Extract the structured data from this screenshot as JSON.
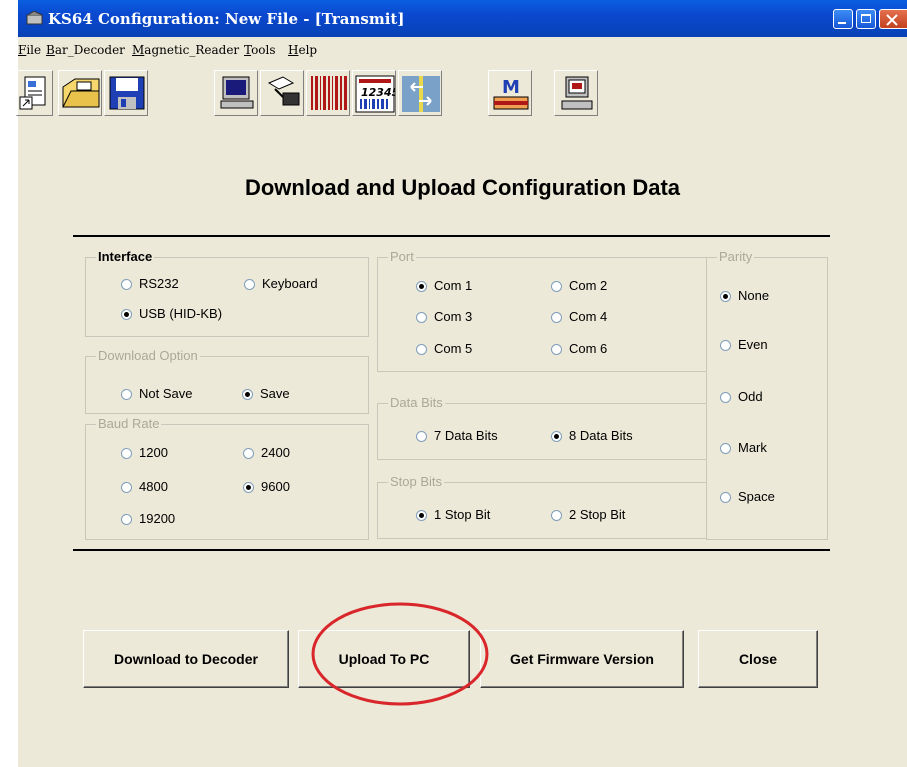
{
  "window": {
    "title": "KS64 Configuration: New File - [Transmit]"
  },
  "menu": [
    {
      "label": "File"
    },
    {
      "label": "Bar_Decoder"
    },
    {
      "label": "Magnetic_Reader"
    },
    {
      "label": "Tools"
    },
    {
      "label": "Help"
    }
  ],
  "toolbar_icons": [
    "new-file-icon",
    "open-folder-icon",
    "save-disk-icon",
    "computer-icon",
    "scanner-icon",
    "barcode-icon",
    "barcode-numbers-icon",
    "transfer-arrows-icon",
    "magnetic-card-icon",
    "terminal-icon"
  ],
  "heading": "Download and Upload Configuration Data",
  "interface": {
    "title": "Interface",
    "options": [
      {
        "label": "RS232",
        "selected": false
      },
      {
        "label": "Keyboard",
        "selected": false
      },
      {
        "label": "USB (HID-KB)",
        "selected": true
      }
    ]
  },
  "download_option": {
    "title": "Download Option",
    "options": [
      {
        "label": "Not Save",
        "selected": false
      },
      {
        "label": "Save",
        "selected": true
      }
    ]
  },
  "baud_rate": {
    "title": "Baud Rate",
    "options": [
      {
        "label": "1200",
        "selected": false
      },
      {
        "label": "2400",
        "selected": false
      },
      {
        "label": "4800",
        "selected": false
      },
      {
        "label": "9600",
        "selected": true
      },
      {
        "label": "19200",
        "selected": false
      }
    ]
  },
  "port": {
    "title": "Port",
    "options": [
      {
        "label": "Com 1",
        "selected": true
      },
      {
        "label": "Com 2",
        "selected": false
      },
      {
        "label": "Com 3",
        "selected": false
      },
      {
        "label": "Com 4",
        "selected": false
      },
      {
        "label": "Com 5",
        "selected": false
      },
      {
        "label": "Com 6",
        "selected": false
      }
    ]
  },
  "data_bits": {
    "title": "Data Bits",
    "options": [
      {
        "label": "7 Data Bits",
        "selected": false
      },
      {
        "label": "8 Data Bits",
        "selected": true
      }
    ]
  },
  "stop_bits": {
    "title": "Stop Bits",
    "options": [
      {
        "label": "1 Stop Bit",
        "selected": true
      },
      {
        "label": "2 Stop Bit",
        "selected": false
      }
    ]
  },
  "parity": {
    "title": "Parity",
    "options": [
      {
        "label": "None",
        "selected": true
      },
      {
        "label": "Even",
        "selected": false
      },
      {
        "label": "Odd",
        "selected": false
      },
      {
        "label": "Mark",
        "selected": false
      },
      {
        "label": "Space",
        "selected": false
      }
    ]
  },
  "buttons": {
    "download": "Download to Decoder",
    "upload": "Upload To PC",
    "firmware": "Get Firmware Version",
    "close": "Close"
  },
  "colors": {
    "titlebar": "#0a48cf",
    "face": "#ece9d8",
    "highlight_circle": "#d9262b"
  }
}
